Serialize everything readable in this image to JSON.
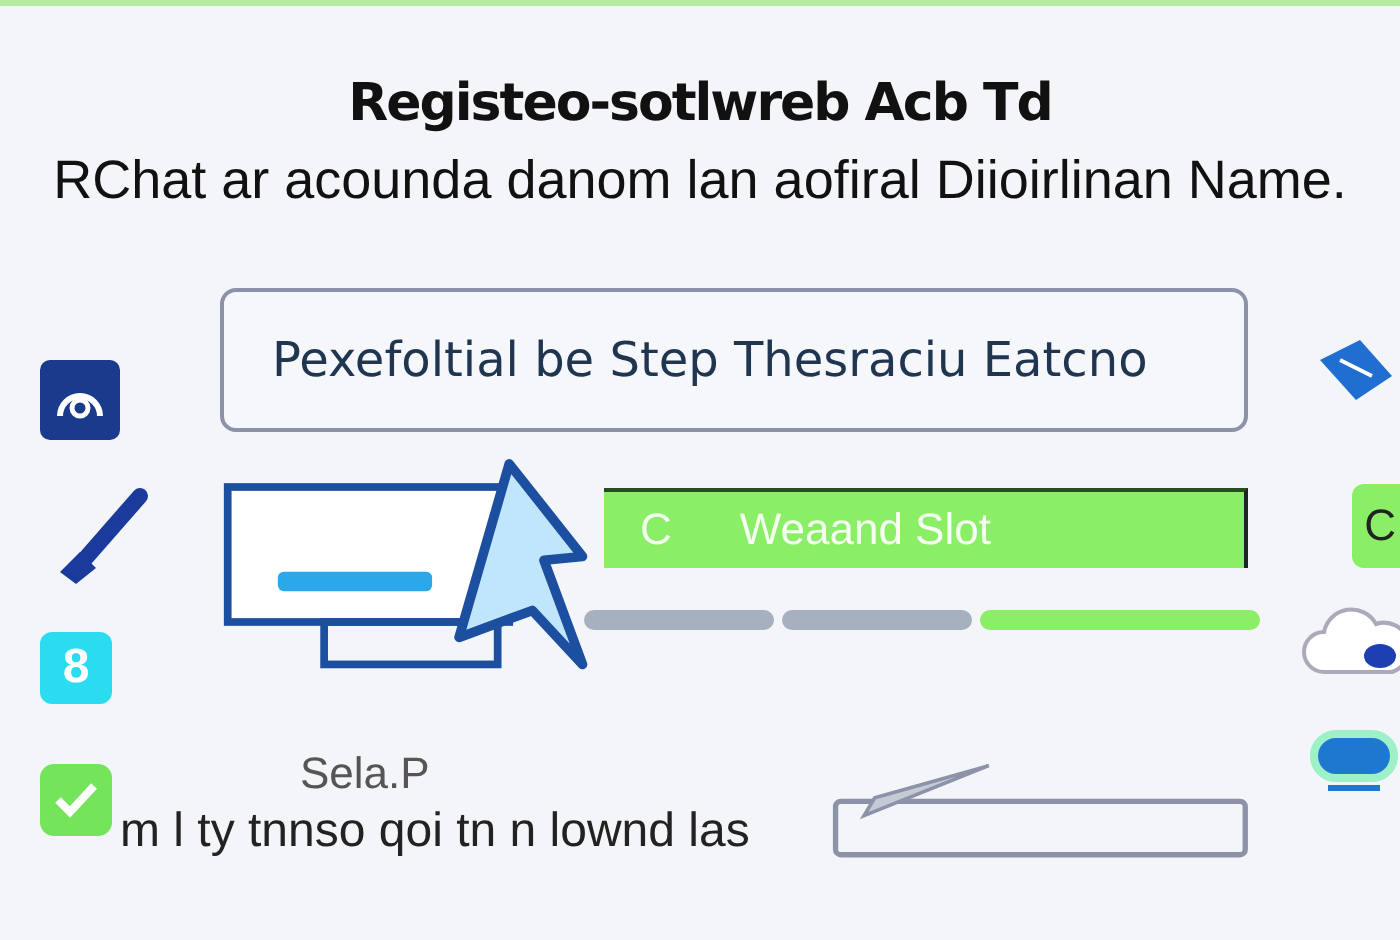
{
  "title": "Registeo-sotlwreb Acb Td",
  "subtitle": "RChat ar acounda danom lan aofiral Diioirlinan Name.",
  "tile_label": "8",
  "checkbox": {
    "checked": true
  },
  "field": {
    "value": "Pexefoltial be Step Thesraciu Eatcno"
  },
  "green_bar": {
    "prefix": "C",
    "label": "Weaand Slot"
  },
  "steps": [
    {
      "done": false
    },
    {
      "done": false
    },
    {
      "done": true
    }
  ],
  "side_button": {
    "label": "C"
  },
  "caption": "Sela.P",
  "note": "m l ty tnnso qoi tn n lownd las"
}
